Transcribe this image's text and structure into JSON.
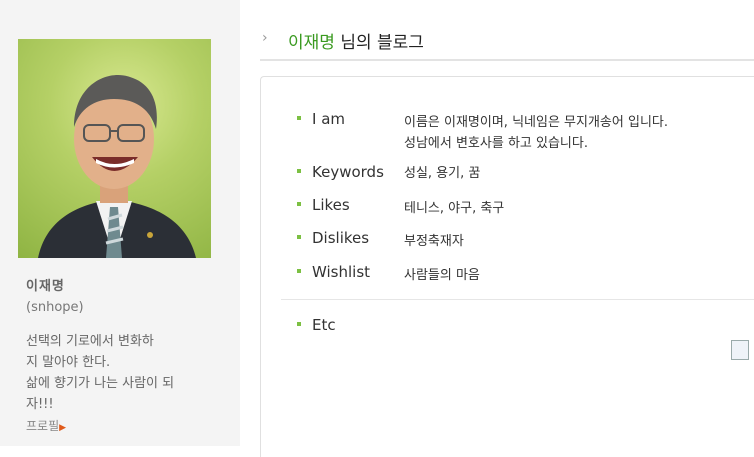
{
  "profile": {
    "name": "이재명",
    "id": "(snhope)",
    "motto_lines": [
      "선택의 기로에서 변화하",
      "지 말아야 한다.",
      "삶에 향기가 나는 사람이 되",
      "자!!!"
    ],
    "link_label": "프로필"
  },
  "header": {
    "owner": "이재명",
    "suffix": " 님의 블로그"
  },
  "info": {
    "i_am": {
      "label": "I am",
      "lines": [
        "이름은 이재명이며, 닉네임은 무지개송어 입니다.",
        "성남에서 변호사를 하고 있습니다."
      ]
    },
    "keywords": {
      "label": "Keywords",
      "value": "성실, 용기, 꿈"
    },
    "likes": {
      "label": "Likes",
      "value": "테니스, 야구, 축구"
    },
    "dislikes": {
      "label": "Dislikes",
      "value": "부정축재자"
    },
    "wishlist": {
      "label": "Wishlist",
      "value": "사람들의 마음"
    },
    "etc": {
      "label": "Etc",
      "value": ""
    }
  },
  "icons": {
    "header_chevron": "chevron-right-icon",
    "profile_link_arrow": "arrow-right-icon",
    "broken_image": "broken-image-icon"
  },
  "colors": {
    "accent_green": "#3a9a20",
    "bullet_green": "#7cc043",
    "link_arrow": "#e05a1a"
  }
}
